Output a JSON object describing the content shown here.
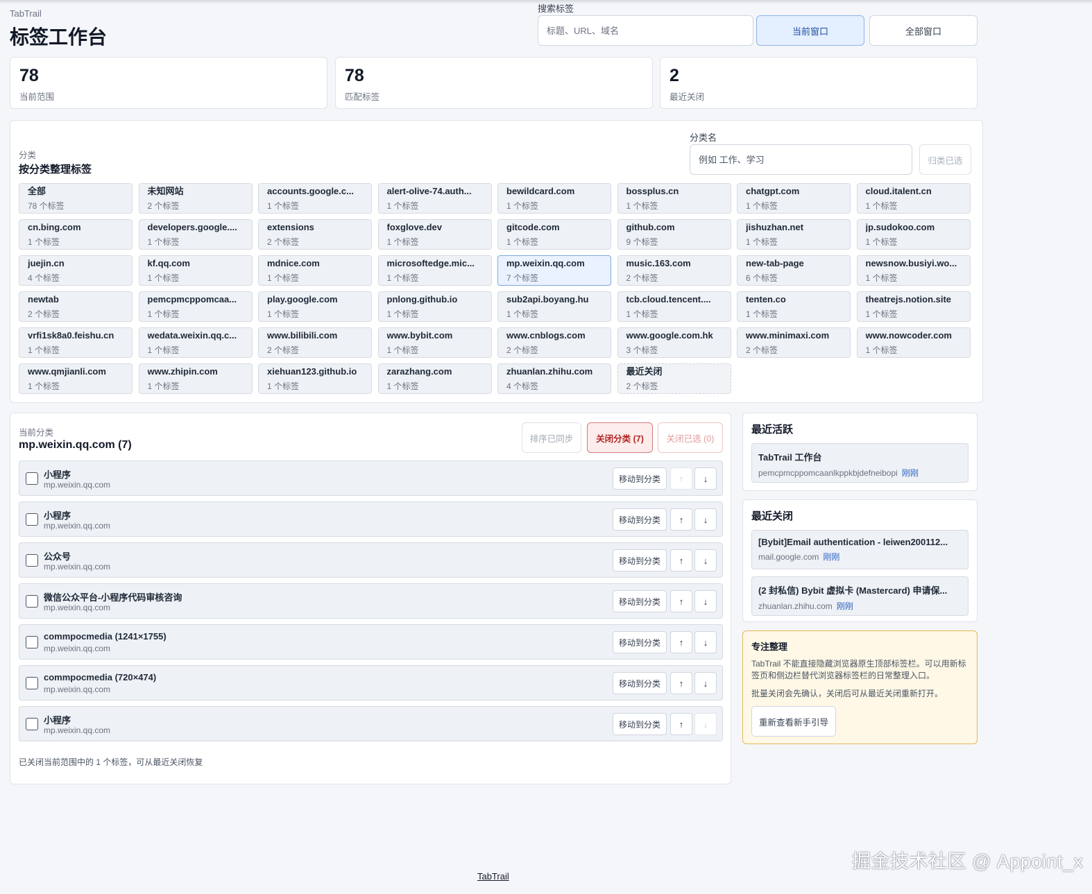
{
  "app": {
    "brand": "TabTrail",
    "title": "标签工作台"
  },
  "search": {
    "label": "搜索标签",
    "placeholder": "标题、URL、域名"
  },
  "window_scope": {
    "current": "当前窗口",
    "all": "全部窗口"
  },
  "stats": [
    {
      "value": "78",
      "label": "当前范围"
    },
    {
      "value": "78",
      "label": "匹配标签"
    },
    {
      "value": "2",
      "label": "最近关闭"
    }
  ],
  "categories": {
    "subtitle": "分类",
    "title": "按分类整理标签",
    "name_label": "分类名",
    "name_placeholder": "例如 工作、学习",
    "assign_button": "归类已选",
    "items": [
      {
        "name": "全部",
        "count": "78 个标签"
      },
      {
        "name": "未知网站",
        "count": "2 个标签"
      },
      {
        "name": "accounts.google.c...",
        "count": "1 个标签"
      },
      {
        "name": "alert-olive-74.auth...",
        "count": "1 个标签"
      },
      {
        "name": "bewildcard.com",
        "count": "1 个标签"
      },
      {
        "name": "bossplus.cn",
        "count": "1 个标签"
      },
      {
        "name": "chatgpt.com",
        "count": "1 个标签"
      },
      {
        "name": "cloud.italent.cn",
        "count": "1 个标签"
      },
      {
        "name": "cn.bing.com",
        "count": "1 个标签"
      },
      {
        "name": "developers.google....",
        "count": "1 个标签"
      },
      {
        "name": "extensions",
        "count": "2 个标签"
      },
      {
        "name": "foxglove.dev",
        "count": "1 个标签"
      },
      {
        "name": "gitcode.com",
        "count": "1 个标签"
      },
      {
        "name": "github.com",
        "count": "9 个标签"
      },
      {
        "name": "jishuzhan.net",
        "count": "1 个标签"
      },
      {
        "name": "jp.sudokoo.com",
        "count": "1 个标签"
      },
      {
        "name": "juejin.cn",
        "count": "4 个标签"
      },
      {
        "name": "kf.qq.com",
        "count": "1 个标签"
      },
      {
        "name": "mdnice.com",
        "count": "1 个标签"
      },
      {
        "name": "microsoftedge.mic...",
        "count": "1 个标签"
      },
      {
        "name": "mp.weixin.qq.com",
        "count": "7 个标签",
        "selected": true
      },
      {
        "name": "music.163.com",
        "count": "2 个标签"
      },
      {
        "name": "new-tab-page",
        "count": "6 个标签"
      },
      {
        "name": "newsnow.busiyi.wo...",
        "count": "1 个标签"
      },
      {
        "name": "newtab",
        "count": "2 个标签"
      },
      {
        "name": "pemcpmcppomcaa...",
        "count": "1 个标签"
      },
      {
        "name": "play.google.com",
        "count": "1 个标签"
      },
      {
        "name": "pnlong.github.io",
        "count": "1 个标签"
      },
      {
        "name": "sub2api.boyang.hu",
        "count": "1 个标签"
      },
      {
        "name": "tcb.cloud.tencent....",
        "count": "1 个标签"
      },
      {
        "name": "tenten.co",
        "count": "1 个标签"
      },
      {
        "name": "theatrejs.notion.site",
        "count": "1 个标签"
      },
      {
        "name": "vrfi1sk8a0.feishu.cn",
        "count": "1 个标签"
      },
      {
        "name": "wedata.weixin.qq.c...",
        "count": "1 个标签"
      },
      {
        "name": "www.bilibili.com",
        "count": "2 个标签"
      },
      {
        "name": "www.bybit.com",
        "count": "1 个标签"
      },
      {
        "name": "www.cnblogs.com",
        "count": "2 个标签"
      },
      {
        "name": "www.google.com.hk",
        "count": "3 个标签"
      },
      {
        "name": "www.minimaxi.com",
        "count": "2 个标签"
      },
      {
        "name": "www.nowcoder.com",
        "count": "1 个标签"
      },
      {
        "name": "www.qmjianli.com",
        "count": "1 个标签"
      },
      {
        "name": "www.zhipin.com",
        "count": "1 个标签"
      },
      {
        "name": "xiehuan123.github.io",
        "count": "1 个标签"
      },
      {
        "name": "zarazhang.com",
        "count": "1 个标签"
      },
      {
        "name": "zhuanlan.zhihu.com",
        "count": "4 个标签"
      },
      {
        "name": "最近关闭",
        "count": "2 个标签",
        "recent": true
      }
    ]
  },
  "current": {
    "subtitle": "当前分类",
    "title": "mp.weixin.qq.com (7)",
    "sync_button": "排序已同步",
    "close_category_button": "关闭分类 (7)",
    "close_selected_button": "关闭已选 (0)",
    "move_label": "移动到分类",
    "up_glyph": "↑",
    "down_glyph": "↓",
    "tabs": [
      {
        "title": "小程序",
        "url": "mp.weixin.qq.com",
        "up_disabled": true,
        "down_disabled": false
      },
      {
        "title": "小程序",
        "url": "mp.weixin.qq.com",
        "up_disabled": false,
        "down_disabled": false
      },
      {
        "title": "公众号",
        "url": "mp.weixin.qq.com",
        "up_disabled": false,
        "down_disabled": false
      },
      {
        "title": "微信公众平台-小程序代码审核咨询",
        "url": "mp.weixin.qq.com",
        "up_disabled": false,
        "down_disabled": false
      },
      {
        "title": "commpocmedia (1241×1755)",
        "url": "mp.weixin.qq.com",
        "up_disabled": false,
        "down_disabled": false
      },
      {
        "title": "commpocmedia (720×474)",
        "url": "mp.weixin.qq.com",
        "up_disabled": false,
        "down_disabled": false
      },
      {
        "title": "小程序",
        "url": "mp.weixin.qq.com",
        "up_disabled": false,
        "down_disabled": true
      }
    ],
    "status": "已关闭当前范围中的 1 个标签，可从最近关闭恢复"
  },
  "recent_active": {
    "title": "最近活跃",
    "items": [
      {
        "title": "TabTrail 工作台",
        "meta": "pemcpmcppomcaanlkppkbjdefneibopi",
        "when": "刚刚"
      }
    ]
  },
  "recent_closed": {
    "title": "最近关闭",
    "items": [
      {
        "title": "[Bybit]Email authentication - leiwen200112...",
        "meta": "mail.google.com",
        "when": "刚刚"
      },
      {
        "title": "(2 封私信) Bybit 虚拟卡 (Mastercard) 申请保...",
        "meta": "zhuanlan.zhihu.com",
        "when": "刚刚"
      }
    ]
  },
  "focus": {
    "title": "专注整理",
    "para1": "TabTrail 不能直接隐藏浏览器原生顶部标签栏。可以用新标签页和侧边栏替代浏览器标签栏的日常整理入口。",
    "para2": "批量关闭会先确认，关闭后可从最近关闭重新打开。",
    "guide_button": "重新查看新手引导"
  },
  "footer": {
    "link": "TabTrail"
  },
  "watermark": "掘金技术社区 @ Appoint_x"
}
